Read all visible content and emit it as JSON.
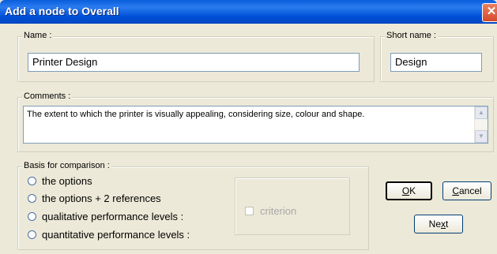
{
  "window": {
    "title": "Add a node to Overall",
    "close_symbol": "✕"
  },
  "name": {
    "label": "Name :",
    "value": "Printer Design"
  },
  "short_name": {
    "label": "Short name :",
    "value": "Design"
  },
  "comments": {
    "label": "Comments :",
    "value": "The extent to which the printer is visually appealing, considering size, colour and shape."
  },
  "basis": {
    "label": "Basis for comparison :",
    "options": [
      "the options",
      "the options + 2 references",
      "qualitative performance levels :",
      "quantitative performance levels :"
    ],
    "criterion_label": "criterion"
  },
  "buttons": {
    "ok": {
      "mnemonic": "O",
      "rest": "K"
    },
    "cancel": {
      "mnemonic": "C",
      "rest": "ancel"
    },
    "next": {
      "pre": "Ne",
      "mnemonic": "x",
      "rest": "t"
    }
  }
}
